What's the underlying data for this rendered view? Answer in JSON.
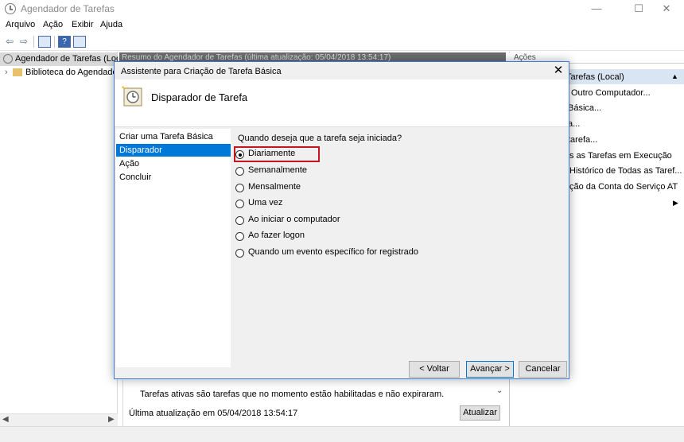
{
  "window": {
    "title": "Agendador de Tarefas",
    "minimize_icon": "—",
    "maximize_icon": "☐",
    "close_icon": "✕"
  },
  "menu": [
    "Arquivo",
    "Ação",
    "Exibir",
    "Ajuda"
  ],
  "toolbar": {
    "back_icon": "⇦",
    "forward_icon": "⇨",
    "help_glyph": "?"
  },
  "tree": {
    "root": "Agendador de Tarefas (Local)",
    "library": "Biblioteca do Agendador",
    "expand_icon": "›"
  },
  "center": {
    "header": "Resumo do Agendador de Tarefas (última atualização: 05/04/2018 13:54:17)",
    "info_text": "Tarefas ativas são tarefas que no momento estão habilitadas e não expiraram.",
    "last_update": "Última atualização em 05/04/2018 13:54:17",
    "update_button": "Atualizar",
    "scroll_down_icon": "⌄"
  },
  "actions_pane": {
    "header": "Ações",
    "group": "Tarefas (Local)",
    "group_collapse_icon": "▲",
    "items": [
      "Outro Computador...",
      "Básica...",
      "a...",
      "tarefa...",
      "s as Tarefas em Execução",
      "Histórico de Todas as Taref...",
      "ção da Conta do Serviço AT",
      ""
    ],
    "submenu_icon": "▶"
  },
  "dialog": {
    "title": "Assistente para Criação de Tarefa Básica",
    "close_icon": "✕",
    "heading": "Disparador de Tarefa",
    "steps": [
      "Criar uma Tarefa Básica",
      "Disparador",
      "Ação",
      "Concluir"
    ],
    "active_step": 1,
    "question": "Quando deseja que a tarefa seja iniciada?",
    "options": [
      "Diariamente",
      "Semanalmente",
      "Mensalmente",
      "Uma vez",
      "Ao iniciar o computador",
      "Ao fazer logon",
      "Quando um evento específico for registrado"
    ],
    "selected_option": 0,
    "buttons": {
      "back": "< Voltar",
      "next": "Avançar >",
      "cancel": "Cancelar"
    },
    "highlight_color": "#c4161c"
  },
  "colors": {
    "accent": "#0078d7",
    "dialog_border": "#3b7bd1",
    "tree_selection": "#d9d9d9"
  }
}
